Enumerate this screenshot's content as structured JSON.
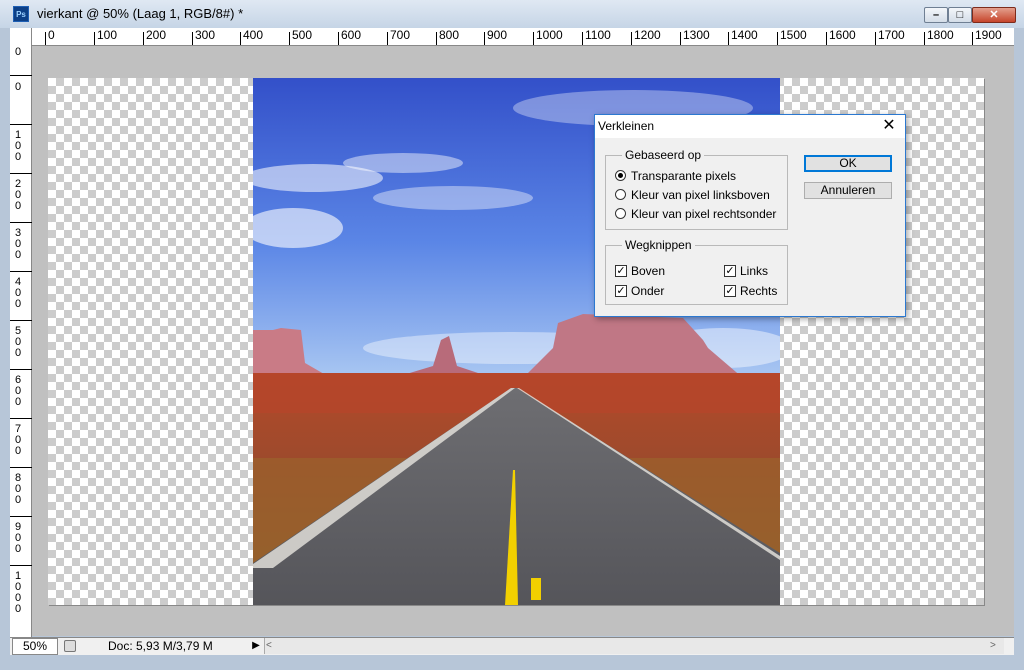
{
  "window": {
    "title": "vierkant @ 50% (Laag 1, RGB/8#) *",
    "app_icon_label": "Ps",
    "controls": {
      "minimize": "–",
      "maximize": "□",
      "close": "✕"
    }
  },
  "ruler": {
    "top_labels": [
      "0",
      "100",
      "200",
      "300",
      "400",
      "500",
      "600",
      "700",
      "800",
      "900",
      "1000",
      "1100",
      "1200",
      "1300",
      "1400",
      "1500",
      "1600",
      "1700",
      "1800",
      "1900"
    ],
    "left_labels": [
      "0",
      "0",
      "1",
      "0",
      "0",
      "2",
      "0",
      "0",
      "3",
      "0",
      "0",
      "4",
      "0",
      "0",
      "5",
      "0",
      "0",
      "6",
      "0",
      "0",
      "7",
      "0",
      "0",
      "8",
      "0",
      "0",
      "9",
      "0",
      "0",
      "1",
      "0",
      "0",
      "0"
    ]
  },
  "status": {
    "zoom": "50%",
    "doc_info": "Doc: 5,93 M/3,79 M",
    "arrow": "▶",
    "scroll_left": "<",
    "scroll_right": ">"
  },
  "dialog": {
    "title": "Verkleinen",
    "close": "✕",
    "group_based_on": {
      "legend": "Gebaseerd op",
      "options": [
        {
          "label": "Transparante pixels",
          "selected": true
        },
        {
          "label": "Kleur van pixel linksboven",
          "selected": false
        },
        {
          "label": "Kleur van pixel rechtsonder",
          "selected": false
        }
      ]
    },
    "group_trim": {
      "legend": "Wegknippen",
      "checks": [
        {
          "label": "Boven",
          "checked": true
        },
        {
          "label": "Links",
          "checked": true
        },
        {
          "label": "Onder",
          "checked": true
        },
        {
          "label": "Rechts",
          "checked": true
        }
      ],
      "check_mark": "✓"
    },
    "ok_label": "OK",
    "cancel_label": "Annuleren"
  },
  "colors": {
    "dialog_border": "#2b78d0",
    "ok_focus": "#0078d7",
    "sky": "#3d63d6",
    "desert": "#b1502a",
    "road_line": "#f2d000"
  }
}
